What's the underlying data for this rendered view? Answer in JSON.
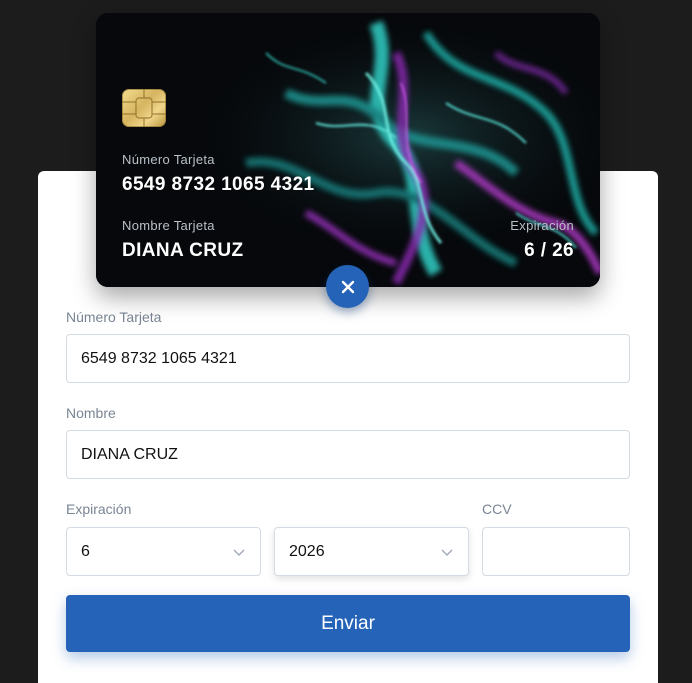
{
  "card": {
    "number_label": "Número Tarjeta",
    "number": "6549 8732 1065 4321",
    "name_label": "Nombre Tarjeta",
    "name": "DIANA CRUZ",
    "expiry_label": "Expiración",
    "expiry": "6 / 26"
  },
  "close_button": {
    "icon": "close-icon"
  },
  "form": {
    "number_label": "Número Tarjeta",
    "number_value": "6549 8732 1065 4321",
    "name_label": "Nombre",
    "name_value": "DIANA CRUZ",
    "expiry_label": "Expiración",
    "month_value": "6",
    "year_value": "2026",
    "ccv_label": "CCV",
    "ccv_value": "",
    "submit_label": "Enviar"
  },
  "colors": {
    "accent": "#2563b8",
    "background": "#1c1c1c",
    "panel": "#ffffff",
    "label": "#7a8594"
  }
}
